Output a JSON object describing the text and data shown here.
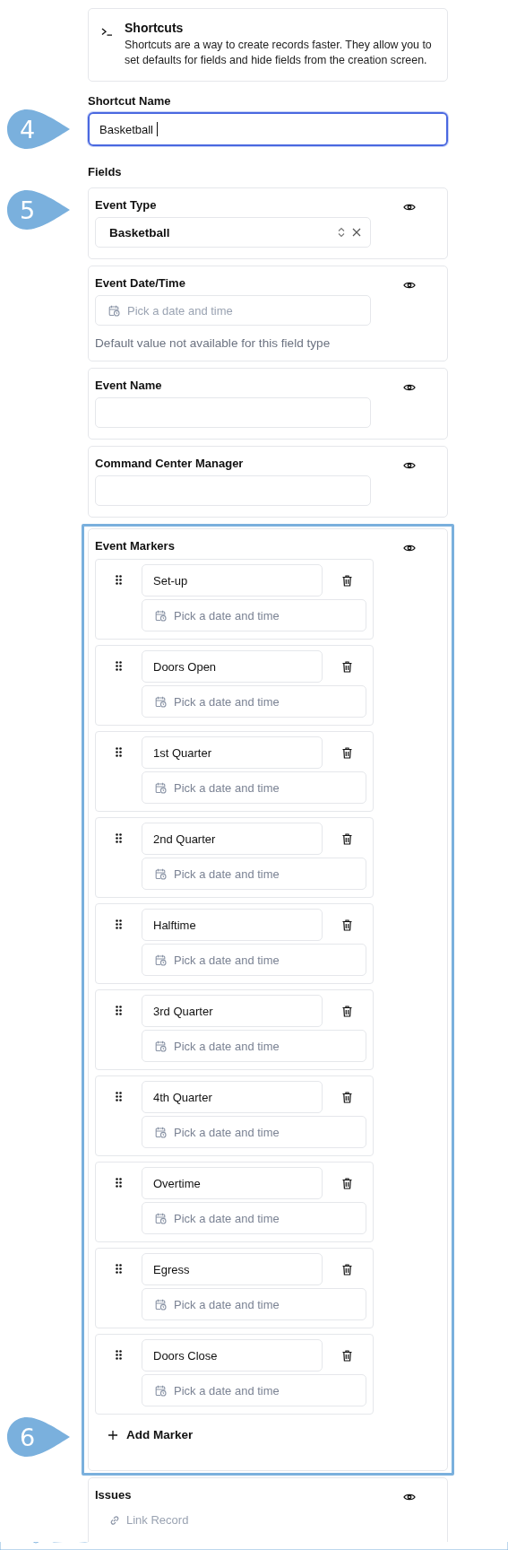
{
  "intro": {
    "title": "Shortcuts",
    "text": "Shortcuts are a way to create records faster. They allow you to set defaults for fields and hide fields from the creation screen."
  },
  "shortcut_name": {
    "label": "Shortcut Name",
    "value": "Basketball",
    "focused": true,
    "callout": "4"
  },
  "fields_label": "Fields",
  "fields": [
    {
      "kind": "select",
      "label": "Event Type",
      "value": "Basketball",
      "callout": "5"
    },
    {
      "kind": "datetime",
      "label": "Event Date/Time",
      "placeholder": "Pick a date and time",
      "note": "Default value not available for this field type"
    },
    {
      "kind": "text",
      "label": "Event Name"
    },
    {
      "kind": "text",
      "label": "Command Center Manager"
    },
    {
      "kind": "markers",
      "label": "Event Markers",
      "highlighted": true,
      "callout": "6",
      "add_label": "Add Marker",
      "markers": [
        {
          "name": "Set-up",
          "placeholder": "Pick a date and time"
        },
        {
          "name": "Doors Open",
          "placeholder": "Pick a date and time"
        },
        {
          "name": "1st Quarter",
          "placeholder": "Pick a date and time"
        },
        {
          "name": "2nd Quarter",
          "placeholder": "Pick a date and time"
        },
        {
          "name": "Halftime",
          "placeholder": "Pick a date and time"
        },
        {
          "name": "3rd Quarter",
          "placeholder": "Pick a date and time"
        },
        {
          "name": "4th Quarter",
          "placeholder": "Pick a date and time"
        },
        {
          "name": "Overtime",
          "placeholder": "Pick a date and time"
        },
        {
          "name": "Egress",
          "placeholder": "Pick a date and time"
        },
        {
          "name": "Doors Close",
          "placeholder": "Pick a date and time"
        }
      ]
    },
    {
      "kind": "link",
      "label": "Issues",
      "placeholder": "Link Record"
    }
  ]
}
